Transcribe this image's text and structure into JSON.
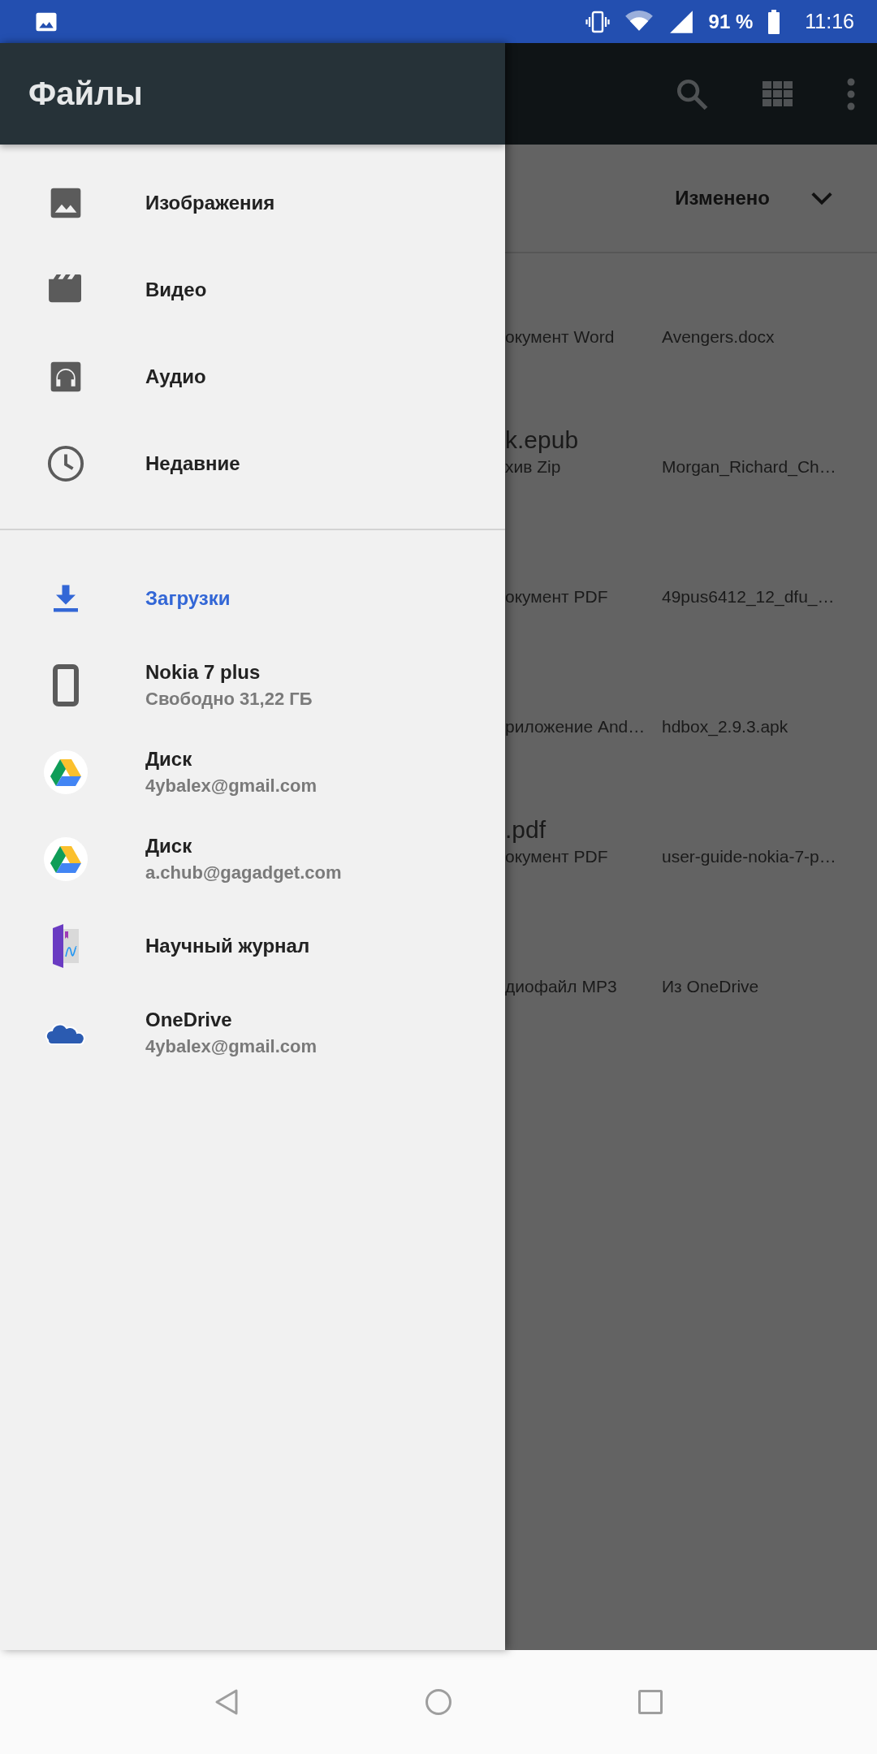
{
  "status_bar": {
    "battery": "91 %",
    "time": "11:16"
  },
  "drawer": {
    "title": "Файлы",
    "sections": [
      {
        "items": [
          {
            "kind": "images",
            "label": "Изображения",
            "selected": false
          },
          {
            "kind": "video",
            "label": "Видео",
            "selected": false
          },
          {
            "kind": "audio",
            "label": "Аудио",
            "selected": false
          },
          {
            "kind": "recent",
            "label": "Недавние",
            "selected": false
          }
        ]
      },
      {
        "items": [
          {
            "kind": "downloads",
            "label": "Загрузки",
            "selected": true
          },
          {
            "kind": "device",
            "label": "Nokia 7 plus",
            "sublabel": "Свободно 31,22 ГБ",
            "selected": false
          },
          {
            "kind": "drive",
            "label": "Диск",
            "sublabel": "4ybalex@gmail.com",
            "selected": false
          },
          {
            "kind": "drive",
            "label": "Диск",
            "sublabel": "a.chub@gagadget.com",
            "selected": false
          },
          {
            "kind": "journal",
            "label": "Научный журнал",
            "selected": false
          },
          {
            "kind": "onedrive",
            "label": "OneDrive",
            "sublabel": "4ybalex@gmail.com",
            "selected": false
          }
        ]
      }
    ]
  },
  "file_list": {
    "sort_label": "Изменено",
    "rows": [
      {
        "type": "окумент Word",
        "name": "Avengers.docx"
      },
      {
        "title": "k.epub",
        "type": "хив Zip",
        "name": "Morgan_Richard_Ch…"
      },
      {
        "type": "окумент PDF",
        "name": "49pus6412_12_dfu_…"
      },
      {
        "type": "риложение And…",
        "name": "hdbox_2.9.3.apk"
      },
      {
        "title": ".pdf",
        "type": "окумент PDF",
        "name": "user-guide-nokia-7-p…"
      },
      {
        "type": "диофайл MP3",
        "name": "Из OneDrive"
      }
    ]
  }
}
